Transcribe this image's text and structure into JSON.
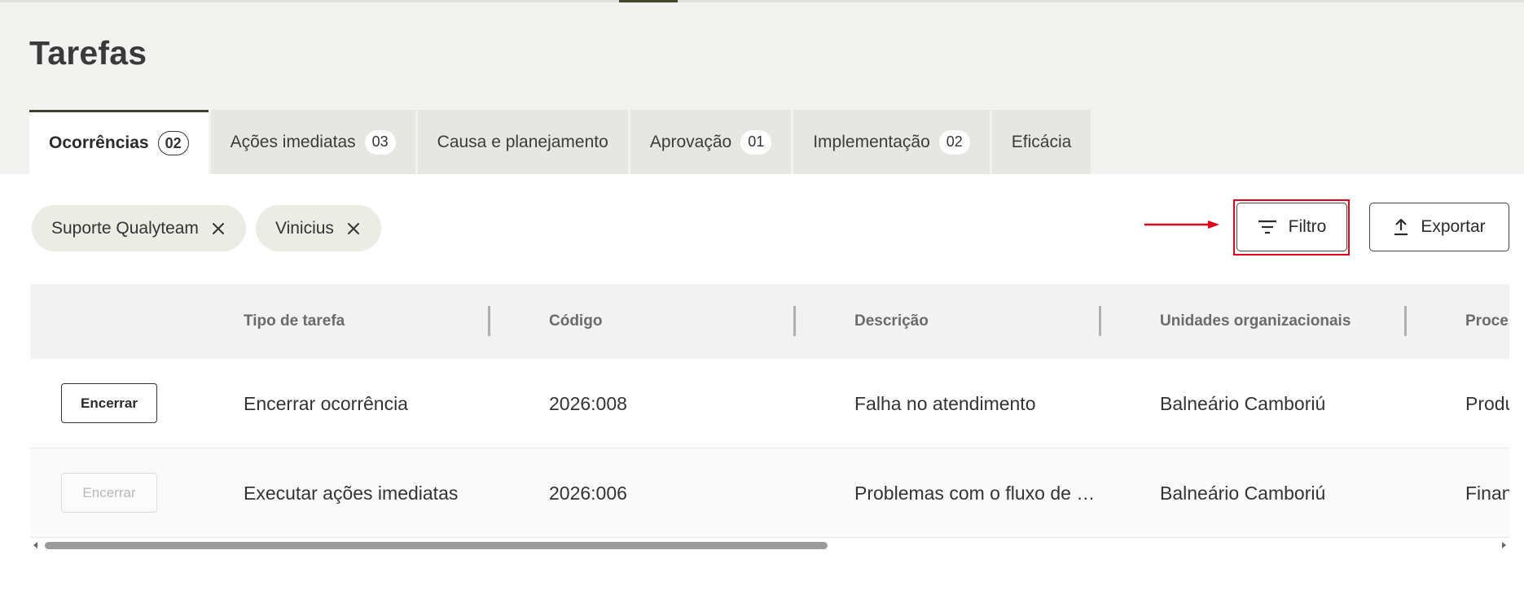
{
  "page": {
    "title": "Tarefas"
  },
  "tabs": [
    {
      "label": "Ocorrências",
      "count": "02",
      "active": true
    },
    {
      "label": "Ações imediatas",
      "count": "03"
    },
    {
      "label": "Causa e planejamento"
    },
    {
      "label": "Aprovação",
      "count": "01"
    },
    {
      "label": "Implementação",
      "count": "02"
    },
    {
      "label": "Eficácia"
    }
  ],
  "filters": {
    "chips": [
      {
        "label": "Suporte Qualyteam"
      },
      {
        "label": "Vinicius"
      }
    ],
    "filter_label": "Filtro",
    "export_label": "Exportar"
  },
  "table": {
    "headers": [
      "Tipo de tarefa",
      "Código",
      "Descrição",
      "Unidades organizacionais",
      "Processos"
    ],
    "rows": [
      {
        "action": "Encerrar",
        "action_enabled": true,
        "tipo": "Encerrar ocorrência",
        "codigo": "2026:008",
        "descricao": "Falha no atendimento",
        "unidade": "Balneário Camboriú",
        "processo": "Produção"
      },
      {
        "action": "Encerrar",
        "action_enabled": false,
        "tipo": "Executar ações imediatas",
        "codigo": "2026:006",
        "descricao": "Problemas com o fluxo de …",
        "unidade": "Balneário Camboriú",
        "processo": "Financeiro"
      }
    ]
  },
  "icons": {
    "filter": "filter-lines-icon",
    "export": "upload-icon",
    "chip_remove": "close-icon"
  },
  "colors": {
    "accent": "#3f3f2a",
    "highlight": "#e3001b",
    "chip_bg": "#ebece4"
  }
}
